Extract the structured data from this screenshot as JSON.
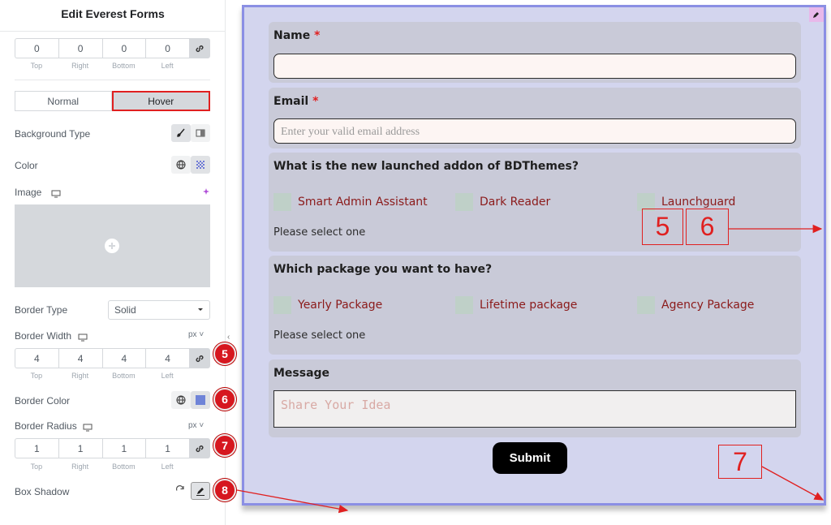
{
  "panel": {
    "title": "Edit Everest Forms",
    "padding_values": [
      "0",
      "0",
      "0",
      "0"
    ],
    "dim_labels": [
      "Top",
      "Right",
      "Bottom",
      "Left"
    ],
    "tabs": [
      "Normal",
      "Hover"
    ],
    "background_type_label": "Background Type",
    "color_label": "Color",
    "image_label": "Image",
    "border_type_label": "Border Type",
    "border_type_value": "Solid",
    "border_width_label": "Border Width",
    "border_width_unit": "px",
    "border_width_values": [
      "4",
      "4",
      "4",
      "4"
    ],
    "border_color_label": "Border Color",
    "border_radius_label": "Border Radius",
    "border_radius_unit": "px",
    "border_radius_values": [
      "1",
      "1",
      "1",
      "1"
    ],
    "box_shadow_label": "Box Shadow",
    "badges": [
      "5",
      "6",
      "7",
      "8"
    ],
    "accent": "#e02020",
    "border_color_swatch": "#6f84d8"
  },
  "form": {
    "name_label": "Name",
    "email_label": "Email",
    "required_mark": "*",
    "email_placeholder": "Enter your valid email address",
    "q1_label": "What is the new launched addon of BDThemes?",
    "q1_options": [
      "Smart Admin Assistant",
      "Dark Reader",
      "Launchguard"
    ],
    "q1_hint": "Please select one",
    "q2_label": "Which package you want to have?",
    "q2_options": [
      "Yearly Package",
      "Lifetime package",
      "Agency Package"
    ],
    "q2_hint": "Please select one",
    "message_label": "Message",
    "message_placeholder": "Share Your Idea",
    "submit_label": "Submit",
    "background": "#d3d5ee",
    "border": "#8b8fe4"
  },
  "annotations": [
    "5",
    "6",
    "7"
  ]
}
